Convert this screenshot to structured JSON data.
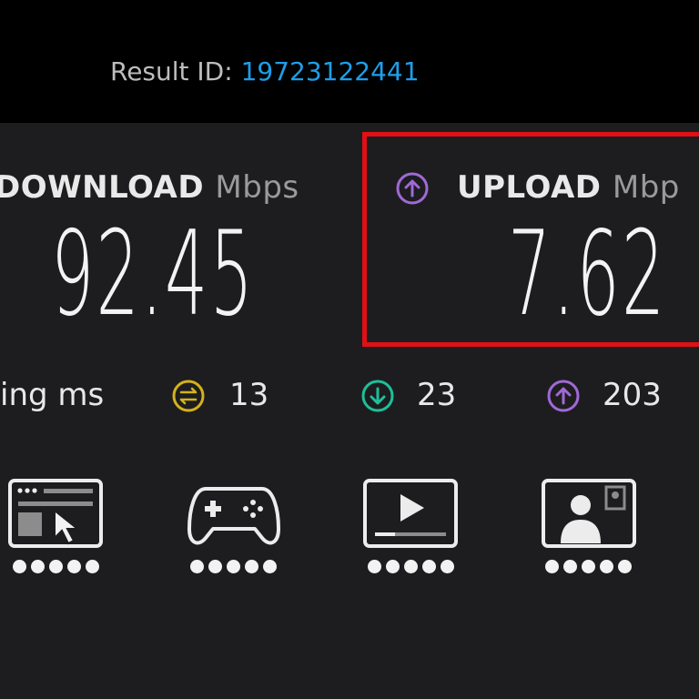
{
  "header": {
    "result_label": "Result ID:",
    "result_id": "19723122441"
  },
  "download": {
    "label": "DOWNLOAD",
    "unit": "Mbps",
    "value": "92.45"
  },
  "upload": {
    "label": "UPLOAD",
    "unit": "Mbp",
    "value": "7.62",
    "highlight_color": "#e01016"
  },
  "ping": {
    "label": "ing ms",
    "idle": "13",
    "download": "23",
    "upload": "203",
    "colors": {
      "idle": "#d4b21a",
      "download": "#1fbf9a",
      "upload": "#a069d6"
    }
  },
  "apps": [
    {
      "icon": "web-browsing-icon",
      "rating": 5
    },
    {
      "icon": "gaming-controller-icon",
      "rating": 5
    },
    {
      "icon": "video-streaming-icon",
      "rating": 5
    },
    {
      "icon": "video-chat-icon",
      "rating": 5
    }
  ]
}
